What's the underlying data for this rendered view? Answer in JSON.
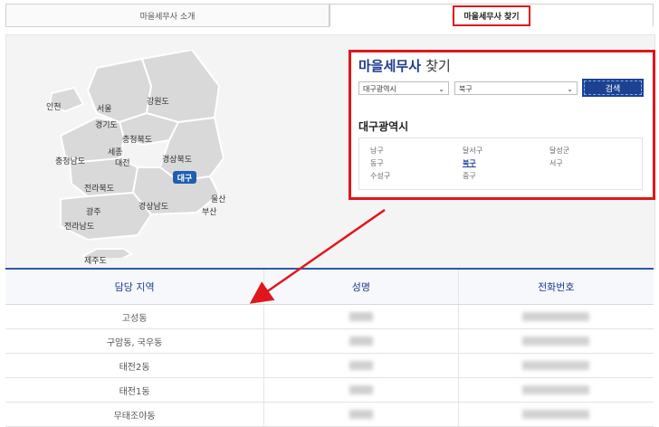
{
  "tabs": [
    {
      "label": "마을세무사 소개",
      "active": false
    },
    {
      "label": "마을세무사 찾기",
      "active": true
    }
  ],
  "map": {
    "labels": {
      "incheon": "인천",
      "seoul": "서울",
      "gangwon": "강원도",
      "gyeonggi": "경기도",
      "chungbuk": "충청북도",
      "sejong": "세종",
      "chungnam": "충청남도",
      "daejeon": "대전",
      "gyeongbuk": "경상북도",
      "jeonbuk": "전라북도",
      "daegu": "대구",
      "ulsan": "울산",
      "gyeongnam": "경상남도",
      "busan": "부산",
      "gwangju": "광주",
      "jeonnam": "전라남도",
      "jeju": "제주도"
    }
  },
  "finder": {
    "title_main": "마을세무사",
    "title_suffix": "찾기",
    "city_select": "대구광역시",
    "district_select": "북구",
    "search_label": "검색",
    "region_title": "대구광역시",
    "districts": [
      "남구",
      "달서구",
      "달성군",
      "동구",
      "북구",
      "서구",
      "수성구",
      "중구"
    ],
    "active_district": "북구"
  },
  "table": {
    "headers": [
      "담당 지역",
      "성명",
      "전화번호"
    ],
    "rows": [
      {
        "area": "고성동"
      },
      {
        "area": "구암동, 국우동"
      },
      {
        "area": "태전2동"
      },
      {
        "area": "태전1동"
      },
      {
        "area": "무태조야동"
      }
    ]
  },
  "colors": {
    "accent_red": "#e0161c",
    "brand_blue": "#1d4191",
    "title_blue": "#1d3c8f"
  }
}
